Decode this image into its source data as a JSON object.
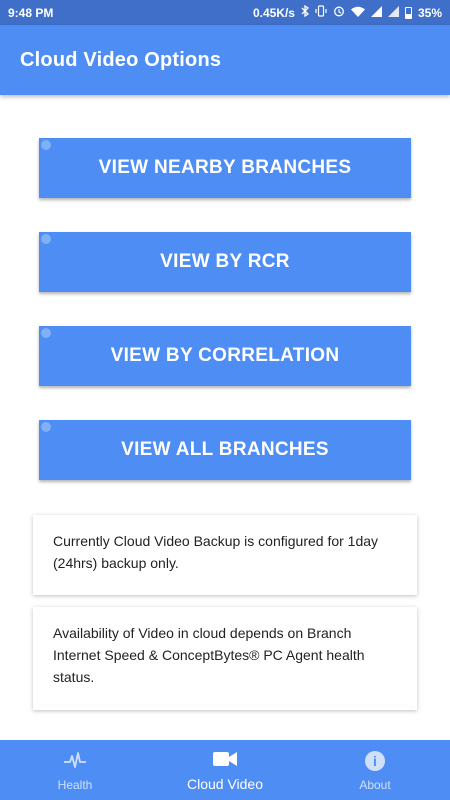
{
  "status_bar": {
    "time": "9:48 PM",
    "network_speed": "0.45K/s",
    "battery": "35%",
    "icons": [
      "bluetooth-icon",
      "vibrate-icon",
      "alarm-icon",
      "wifi-icon",
      "signal-icon",
      "signal-icon",
      "battery-icon"
    ]
  },
  "app_bar": {
    "title": "Cloud Video Options"
  },
  "options": [
    {
      "label": "VIEW NEARBY BRANCHES"
    },
    {
      "label": "VIEW BY RCR"
    },
    {
      "label": "VIEW BY CORRELATION"
    },
    {
      "label": "VIEW ALL BRANCHES"
    }
  ],
  "info_cards": [
    {
      "text": "Currently Cloud Video Backup is configured for 1day (24hrs) backup only."
    },
    {
      "text": "Availability of Video in cloud depends on Branch Internet Speed & ConceptBytes® PC Agent health status."
    }
  ],
  "bottom_nav": [
    {
      "label": "Health",
      "icon": "heartbeat-icon",
      "active": false
    },
    {
      "label": "Cloud Video",
      "icon": "video-camera-icon",
      "active": true
    },
    {
      "label": "About",
      "icon": "info-icon",
      "active": false
    }
  ],
  "colors": {
    "primary": "#4e8ef4",
    "status_bar": "#3f6fc9",
    "background": "#ffffff"
  }
}
